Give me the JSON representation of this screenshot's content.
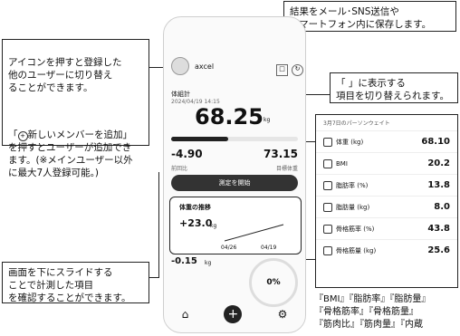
{
  "callouts": {
    "save_share": "結果をメール･SNS送信や\nスマートフォン内に保存します。",
    "switch_user": "アイコンを押すと登録した\n他のユーザーに切り替え\nることができます。",
    "add_member_prefix": "「",
    "add_member_rest": "新しいメンバーを追加」\nを押すとユーザーが追加でき\nます。(※メインユーザー以外\nに最大7人登録可能。)",
    "display_item": "「 」に表示する\n項目を切り替えられます。",
    "scroll_items": "画面を下にスライドする\nことで計測した項目\nを確認することができます。",
    "metrics_list": "『BMI』『脂肪率』『脂肪量』\n『骨格筋率』『骨格筋量』\n『筋肉比』『筋肉量』『内蔵"
  },
  "phone": {
    "user": "axcel",
    "date_label": "体組計",
    "date_value": "2024/04/19 14:15",
    "main_value": "68.25",
    "main_unit": "kg",
    "diff_value": "-4.90",
    "diff_label": "前回比",
    "target_value": "73.15",
    "target_label": "目標体重",
    "start_button": "測定を開始",
    "trend_title": "体重の推移",
    "trend_value": "+23.0",
    "trend_unit": "kg",
    "trend_x1": "04/26",
    "trend_x2": "04/19",
    "sub_value": "-0.15",
    "sub_unit": "kg",
    "percent": "0%"
  },
  "panel": {
    "header": "3月7日のパーソンウェイト",
    "rows": [
      {
        "icon": "body-icon",
        "label": "体重 (kg)",
        "value": "68.10"
      },
      {
        "icon": "bmi-icon",
        "label": "BMI",
        "value": "20.2"
      },
      {
        "icon": "fat-icon",
        "label": "脂肪率 (%)",
        "value": "13.8"
      },
      {
        "icon": "fat-mass-icon",
        "label": "脂肪量 (kg)",
        "value": "8.0"
      },
      {
        "icon": "muscle-icon",
        "label": "骨格筋率 (%)",
        "value": "43.8"
      },
      {
        "icon": "muscle-mass-icon",
        "label": "骨格筋量 (kg)",
        "value": "25.6"
      }
    ]
  }
}
